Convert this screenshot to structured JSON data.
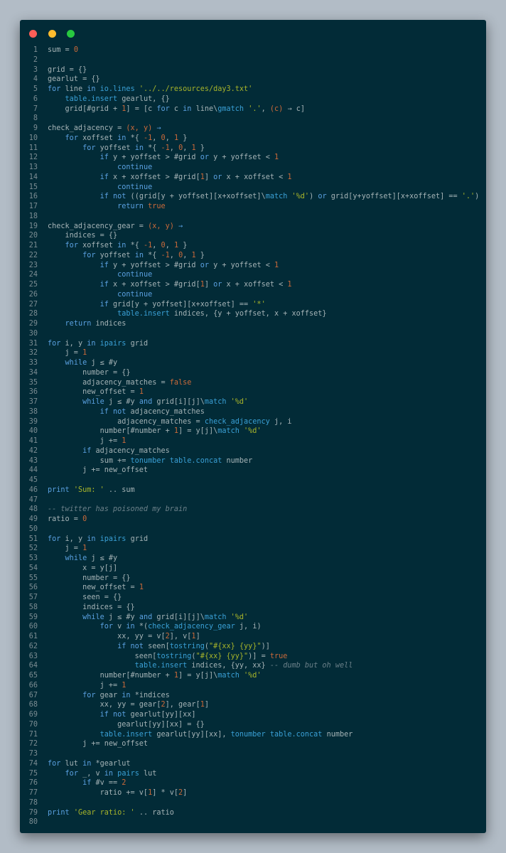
{
  "window_controls": [
    "close",
    "minimize",
    "maximize"
  ],
  "colors": {
    "background": "#b2bcc6",
    "editor": "#022b37",
    "keyword": "#5aa0e0",
    "number": "#cb6a3a",
    "string": "#a7b42a",
    "comment": "#6b8089"
  },
  "code_lines": [
    [
      [
        "id",
        "sum = "
      ],
      [
        "num",
        "0"
      ]
    ],
    [],
    [
      [
        "id",
        "grid = {}"
      ]
    ],
    [
      [
        "id",
        "gearlut = {}"
      ]
    ],
    [
      [
        "kw",
        "for"
      ],
      [
        "id",
        " line "
      ],
      [
        "kw",
        "in"
      ],
      [
        "fn",
        " io.lines "
      ],
      [
        "str",
        "'../../resources/day3.txt'"
      ]
    ],
    [
      [
        "id",
        "    "
      ],
      [
        "fn",
        "table.insert"
      ],
      [
        "id",
        " gearlut, {}"
      ]
    ],
    [
      [
        "id",
        "    grid[#grid + "
      ],
      [
        "num",
        "1"
      ],
      [
        "id",
        "] = [c "
      ],
      [
        "kw",
        "for"
      ],
      [
        "id",
        " c "
      ],
      [
        "kw",
        "in"
      ],
      [
        "id",
        " line\\"
      ],
      [
        "fn",
        "gmatch"
      ],
      [
        "id",
        " "
      ],
      [
        "str",
        "'.'"
      ],
      [
        "id",
        ", "
      ],
      [
        "par",
        "(c)"
      ],
      [
        "id",
        " → c]"
      ]
    ],
    [],
    [
      [
        "id",
        "check_adjacency = "
      ],
      [
        "par",
        "(x, y)"
      ],
      [
        "kw",
        " →"
      ]
    ],
    [
      [
        "id",
        "    "
      ],
      [
        "kw",
        "for"
      ],
      [
        "id",
        " xoffset "
      ],
      [
        "kw",
        "in"
      ],
      [
        "id",
        " *{ "
      ],
      [
        "num",
        "-1"
      ],
      [
        "id",
        ", "
      ],
      [
        "num",
        "0"
      ],
      [
        "id",
        ", "
      ],
      [
        "num",
        "1"
      ],
      [
        "id",
        " }"
      ]
    ],
    [
      [
        "id",
        "        "
      ],
      [
        "kw",
        "for"
      ],
      [
        "id",
        " yoffset "
      ],
      [
        "kw",
        "in"
      ],
      [
        "id",
        " *{ "
      ],
      [
        "num",
        "-1"
      ],
      [
        "id",
        ", "
      ],
      [
        "num",
        "0"
      ],
      [
        "id",
        ", "
      ],
      [
        "num",
        "1"
      ],
      [
        "id",
        " }"
      ]
    ],
    [
      [
        "id",
        "            "
      ],
      [
        "kw",
        "if"
      ],
      [
        "id",
        " y + yoffset > #grid "
      ],
      [
        "kw",
        "or"
      ],
      [
        "id",
        " y + yoffset < "
      ],
      [
        "num",
        "1"
      ]
    ],
    [
      [
        "id",
        "                "
      ],
      [
        "kw",
        "continue"
      ]
    ],
    [
      [
        "id",
        "            "
      ],
      [
        "kw",
        "if"
      ],
      [
        "id",
        " x + xoffset > #grid["
      ],
      [
        "num",
        "1"
      ],
      [
        "id",
        "] "
      ],
      [
        "kw",
        "or"
      ],
      [
        "id",
        " x + xoffset < "
      ],
      [
        "num",
        "1"
      ]
    ],
    [
      [
        "id",
        "                "
      ],
      [
        "kw",
        "continue"
      ]
    ],
    [
      [
        "id",
        "            "
      ],
      [
        "kw",
        "if not"
      ],
      [
        "id",
        " ((grid[y + yoffset][x+xoffset]\\"
      ],
      [
        "fn",
        "match"
      ],
      [
        "id",
        " "
      ],
      [
        "str",
        "'%d'"
      ],
      [
        "id",
        ") "
      ],
      [
        "kw",
        "or"
      ],
      [
        "id",
        " grid[y+yoffset][x+xoffset] == "
      ],
      [
        "str",
        "'.'"
      ],
      [
        "id",
        ")"
      ]
    ],
    [
      [
        "id",
        "                "
      ],
      [
        "kw",
        "return"
      ],
      [
        "num",
        " true"
      ]
    ],
    [],
    [
      [
        "id",
        "check_adjacency_gear = "
      ],
      [
        "par",
        "(x, y)"
      ],
      [
        "kw",
        " →"
      ]
    ],
    [
      [
        "id",
        "    indices = {}"
      ]
    ],
    [
      [
        "id",
        "    "
      ],
      [
        "kw",
        "for"
      ],
      [
        "id",
        " xoffset "
      ],
      [
        "kw",
        "in"
      ],
      [
        "id",
        " *{ "
      ],
      [
        "num",
        "-1"
      ],
      [
        "id",
        ", "
      ],
      [
        "num",
        "0"
      ],
      [
        "id",
        ", "
      ],
      [
        "num",
        "1"
      ],
      [
        "id",
        " }"
      ]
    ],
    [
      [
        "id",
        "        "
      ],
      [
        "kw",
        "for"
      ],
      [
        "id",
        " yoffset "
      ],
      [
        "kw",
        "in"
      ],
      [
        "id",
        " *{ "
      ],
      [
        "num",
        "-1"
      ],
      [
        "id",
        ", "
      ],
      [
        "num",
        "0"
      ],
      [
        "id",
        ", "
      ],
      [
        "num",
        "1"
      ],
      [
        "id",
        " }"
      ]
    ],
    [
      [
        "id",
        "            "
      ],
      [
        "kw",
        "if"
      ],
      [
        "id",
        " y + yoffset > #grid "
      ],
      [
        "kw",
        "or"
      ],
      [
        "id",
        " y + yoffset < "
      ],
      [
        "num",
        "1"
      ]
    ],
    [
      [
        "id",
        "                "
      ],
      [
        "kw",
        "continue"
      ]
    ],
    [
      [
        "id",
        "            "
      ],
      [
        "kw",
        "if"
      ],
      [
        "id",
        " x + xoffset > #grid["
      ],
      [
        "num",
        "1"
      ],
      [
        "id",
        "] "
      ],
      [
        "kw",
        "or"
      ],
      [
        "id",
        " x + xoffset < "
      ],
      [
        "num",
        "1"
      ]
    ],
    [
      [
        "id",
        "                "
      ],
      [
        "kw",
        "continue"
      ]
    ],
    [
      [
        "id",
        "            "
      ],
      [
        "kw",
        "if"
      ],
      [
        "id",
        " grid[y + yoffset][x+xoffset] == "
      ],
      [
        "str",
        "'*'"
      ]
    ],
    [
      [
        "id",
        "                "
      ],
      [
        "fn",
        "table.insert"
      ],
      [
        "id",
        " indices, {y + yoffset, x + xoffset}"
      ]
    ],
    [
      [
        "id",
        "    "
      ],
      [
        "kw",
        "return"
      ],
      [
        "id",
        " indices"
      ]
    ],
    [],
    [
      [
        "kw",
        "for"
      ],
      [
        "id",
        " i, y "
      ],
      [
        "kw",
        "in"
      ],
      [
        "fn",
        " ipairs"
      ],
      [
        "id",
        " grid"
      ]
    ],
    [
      [
        "id",
        "    j = "
      ],
      [
        "num",
        "1"
      ]
    ],
    [
      [
        "id",
        "    "
      ],
      [
        "kw",
        "while"
      ],
      [
        "id",
        " j ≤ #y"
      ]
    ],
    [
      [
        "id",
        "        number = {}"
      ]
    ],
    [
      [
        "id",
        "        adjacency_matches = "
      ],
      [
        "num",
        "false"
      ]
    ],
    [
      [
        "id",
        "        new_offset = "
      ],
      [
        "num",
        "1"
      ]
    ],
    [
      [
        "id",
        "        "
      ],
      [
        "kw",
        "while"
      ],
      [
        "id",
        " j ≤ #y "
      ],
      [
        "kw",
        "and"
      ],
      [
        "id",
        " grid[i][j]\\"
      ],
      [
        "fn",
        "match"
      ],
      [
        "id",
        " "
      ],
      [
        "str",
        "'%d'"
      ]
    ],
    [
      [
        "id",
        "            "
      ],
      [
        "kw",
        "if not"
      ],
      [
        "id",
        " adjacency_matches"
      ]
    ],
    [
      [
        "id",
        "                adjacency_matches = "
      ],
      [
        "fn",
        "check_adjacency"
      ],
      [
        "id",
        " j, i"
      ]
    ],
    [
      [
        "id",
        "            number[#number + "
      ],
      [
        "num",
        "1"
      ],
      [
        "id",
        "] = y[j]\\"
      ],
      [
        "fn",
        "match"
      ],
      [
        "id",
        " "
      ],
      [
        "str",
        "'%d'"
      ]
    ],
    [
      [
        "id",
        "            j += "
      ],
      [
        "num",
        "1"
      ]
    ],
    [
      [
        "id",
        "        "
      ],
      [
        "kw",
        "if"
      ],
      [
        "id",
        " adjacency_matches"
      ]
    ],
    [
      [
        "id",
        "            sum += "
      ],
      [
        "fn",
        "tonumber"
      ],
      [
        "fn",
        " table.concat"
      ],
      [
        "id",
        " number"
      ]
    ],
    [
      [
        "id",
        "        j += new_offset"
      ]
    ],
    [],
    [
      [
        "kw",
        "print"
      ],
      [
        "id",
        " "
      ],
      [
        "str",
        "'Sum: '"
      ],
      [
        "id",
        " .. sum"
      ]
    ],
    [],
    [
      [
        "cm",
        "-- twitter has poisoned my brain"
      ]
    ],
    [
      [
        "id",
        "ratio = "
      ],
      [
        "num",
        "0"
      ]
    ],
    [],
    [
      [
        "kw",
        "for"
      ],
      [
        "id",
        " i, y "
      ],
      [
        "kw",
        "in"
      ],
      [
        "fn",
        " ipairs"
      ],
      [
        "id",
        " grid"
      ]
    ],
    [
      [
        "id",
        "    j = "
      ],
      [
        "num",
        "1"
      ]
    ],
    [
      [
        "id",
        "    "
      ],
      [
        "kw",
        "while"
      ],
      [
        "id",
        " j ≤ #y"
      ]
    ],
    [
      [
        "id",
        "        x = y[j]"
      ]
    ],
    [
      [
        "id",
        "        number = {}"
      ]
    ],
    [
      [
        "id",
        "        new_offset = "
      ],
      [
        "num",
        "1"
      ]
    ],
    [
      [
        "id",
        "        seen = {}"
      ]
    ],
    [
      [
        "id",
        "        indices = {}"
      ]
    ],
    [
      [
        "id",
        "        "
      ],
      [
        "kw",
        "while"
      ],
      [
        "id",
        " j ≤ #y "
      ],
      [
        "kw",
        "and"
      ],
      [
        "id",
        " grid[i][j]\\"
      ],
      [
        "fn",
        "match"
      ],
      [
        "id",
        " "
      ],
      [
        "str",
        "'%d'"
      ]
    ],
    [
      [
        "id",
        "            "
      ],
      [
        "kw",
        "for"
      ],
      [
        "id",
        " v "
      ],
      [
        "kw",
        "in"
      ],
      [
        "id",
        " *("
      ],
      [
        "fn",
        "check_adjacency_gear"
      ],
      [
        "id",
        " j, i)"
      ]
    ],
    [
      [
        "id",
        "                xx, yy = v["
      ],
      [
        "num",
        "2"
      ],
      [
        "id",
        "], v["
      ],
      [
        "num",
        "1"
      ],
      [
        "id",
        "]"
      ]
    ],
    [
      [
        "id",
        "                "
      ],
      [
        "kw",
        "if not"
      ],
      [
        "id",
        " seen["
      ],
      [
        "fn",
        "tostring"
      ],
      [
        "id",
        "("
      ],
      [
        "str",
        "\"#{xx} {yy}\""
      ],
      [
        "id",
        ")]"
      ]
    ],
    [
      [
        "id",
        "                    seen["
      ],
      [
        "fn",
        "tostring"
      ],
      [
        "id",
        "("
      ],
      [
        "str",
        "\"#{xx} {yy}\""
      ],
      [
        "id",
        ")] = "
      ],
      [
        "num",
        "true"
      ]
    ],
    [
      [
        "id",
        "                    "
      ],
      [
        "fn",
        "table.insert"
      ],
      [
        "id",
        " indices, {yy, xx} "
      ],
      [
        "cm",
        "-- dumb but oh well"
      ]
    ],
    [
      [
        "id",
        "            number[#number + "
      ],
      [
        "num",
        "1"
      ],
      [
        "id",
        "] = y[j]\\"
      ],
      [
        "fn",
        "match"
      ],
      [
        "id",
        " "
      ],
      [
        "str",
        "'%d'"
      ]
    ],
    [
      [
        "id",
        "            j += "
      ],
      [
        "num",
        "1"
      ]
    ],
    [
      [
        "id",
        "        "
      ],
      [
        "kw",
        "for"
      ],
      [
        "id",
        " gear "
      ],
      [
        "kw",
        "in"
      ],
      [
        "id",
        " *indices"
      ]
    ],
    [
      [
        "id",
        "            xx, yy = gear["
      ],
      [
        "num",
        "2"
      ],
      [
        "id",
        "], gear["
      ],
      [
        "num",
        "1"
      ],
      [
        "id",
        "]"
      ]
    ],
    [
      [
        "id",
        "            "
      ],
      [
        "kw",
        "if not"
      ],
      [
        "id",
        " gearlut[yy][xx]"
      ]
    ],
    [
      [
        "id",
        "                gearlut[yy][xx] = {}"
      ]
    ],
    [
      [
        "id",
        "            "
      ],
      [
        "fn",
        "table.insert"
      ],
      [
        "id",
        " gearlut[yy][xx], "
      ],
      [
        "fn",
        "tonumber"
      ],
      [
        "fn",
        " table.concat"
      ],
      [
        "id",
        " number"
      ]
    ],
    [
      [
        "id",
        "        j += new_offset"
      ]
    ],
    [],
    [
      [
        "kw",
        "for"
      ],
      [
        "id",
        " lut "
      ],
      [
        "kw",
        "in"
      ],
      [
        "id",
        " *gearlut"
      ]
    ],
    [
      [
        "id",
        "    "
      ],
      [
        "kw",
        "for"
      ],
      [
        "id",
        " _, v "
      ],
      [
        "kw",
        "in"
      ],
      [
        "fn",
        " pairs"
      ],
      [
        "id",
        " lut"
      ]
    ],
    [
      [
        "id",
        "        "
      ],
      [
        "kw",
        "if"
      ],
      [
        "id",
        " #v == "
      ],
      [
        "num",
        "2"
      ]
    ],
    [
      [
        "id",
        "            ratio += v["
      ],
      [
        "num",
        "1"
      ],
      [
        "id",
        "] * v["
      ],
      [
        "num",
        "2"
      ],
      [
        "id",
        "]"
      ]
    ],
    [],
    [
      [
        "kw",
        "print"
      ],
      [
        "id",
        " "
      ],
      [
        "str",
        "'Gear ratio: '"
      ],
      [
        "id",
        " .. ratio"
      ]
    ],
    []
  ]
}
